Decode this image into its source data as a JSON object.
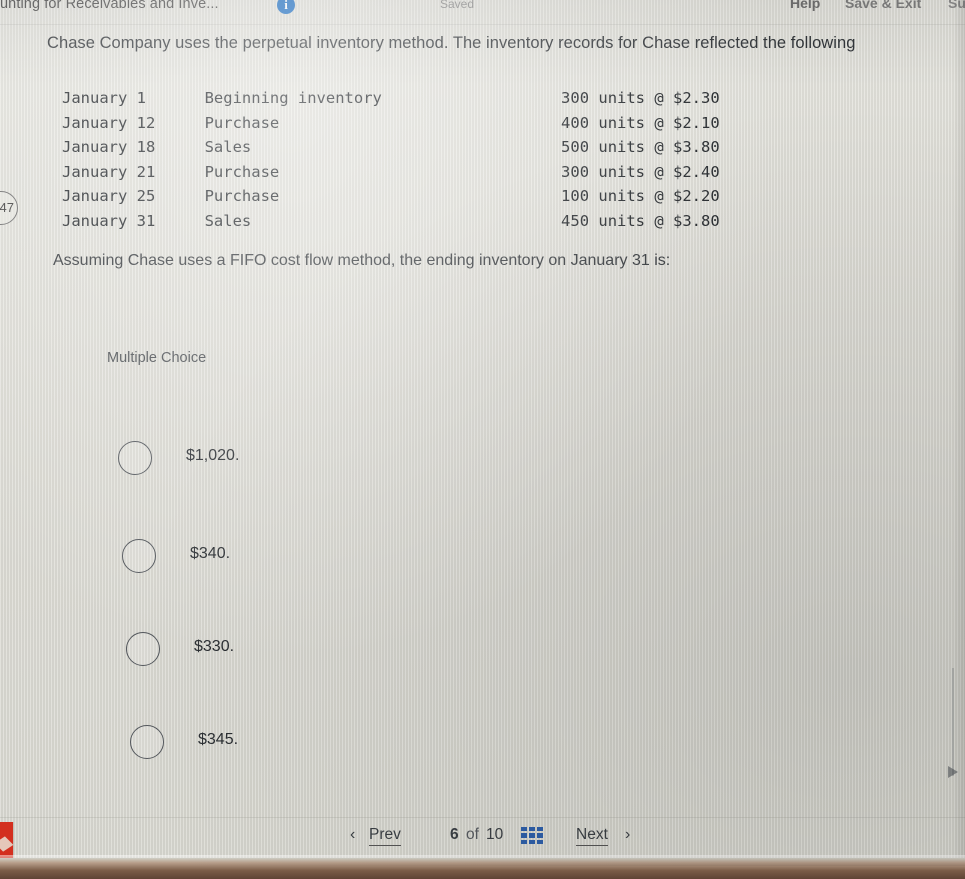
{
  "topbar": {
    "title": "unting for Receivables and Inve...",
    "info_icon": "info-icon",
    "saved_status": "Saved",
    "help_label": "Help",
    "save_exit_label": "Save & Exit",
    "extra_label": "Su"
  },
  "side_badge": {
    "label": "47"
  },
  "question": {
    "stem": "Chase Company uses the perpetual inventory method. The inventory records for Chase reflected the following",
    "prompt": "Assuming Chase uses a FIFO cost flow method, the ending inventory on January 31 is:",
    "type_label": "Multiple Choice"
  },
  "inventory_rows": [
    {
      "date": "January 1",
      "description": "Beginning inventory",
      "detail": "300 units @ $2.30"
    },
    {
      "date": "January 12",
      "description": "Purchase",
      "detail": "400 units @ $2.10"
    },
    {
      "date": "January 18",
      "description": "Sales",
      "detail": "500 units @ $3.80"
    },
    {
      "date": "January 21",
      "description": "Purchase",
      "detail": "300 units @ $2.40"
    },
    {
      "date": "January 25",
      "description": "Purchase",
      "detail": "100 units @ $2.20"
    },
    {
      "date": "January 31",
      "description": "Sales",
      "detail": "450 units @ $3.80"
    }
  ],
  "options": [
    {
      "label": "$1,020.",
      "selected": false
    },
    {
      "label": "$340.",
      "selected": false
    },
    {
      "label": "$330.",
      "selected": false
    },
    {
      "label": "$345.",
      "selected": false
    }
  ],
  "pager": {
    "prev_label": "Prev",
    "prev_arrow": "‹",
    "current": "6",
    "of_label": "of",
    "total": "10",
    "grid_icon": "grid-icon",
    "next_label": "Next",
    "next_arrow": "›"
  },
  "colors": {
    "accent_blue": "#1d6fc4",
    "grid_blue": "#2e5fa8",
    "page_background": "#dcdcd6",
    "text": "#32363a",
    "taskbar_red": "#d32f1f"
  }
}
